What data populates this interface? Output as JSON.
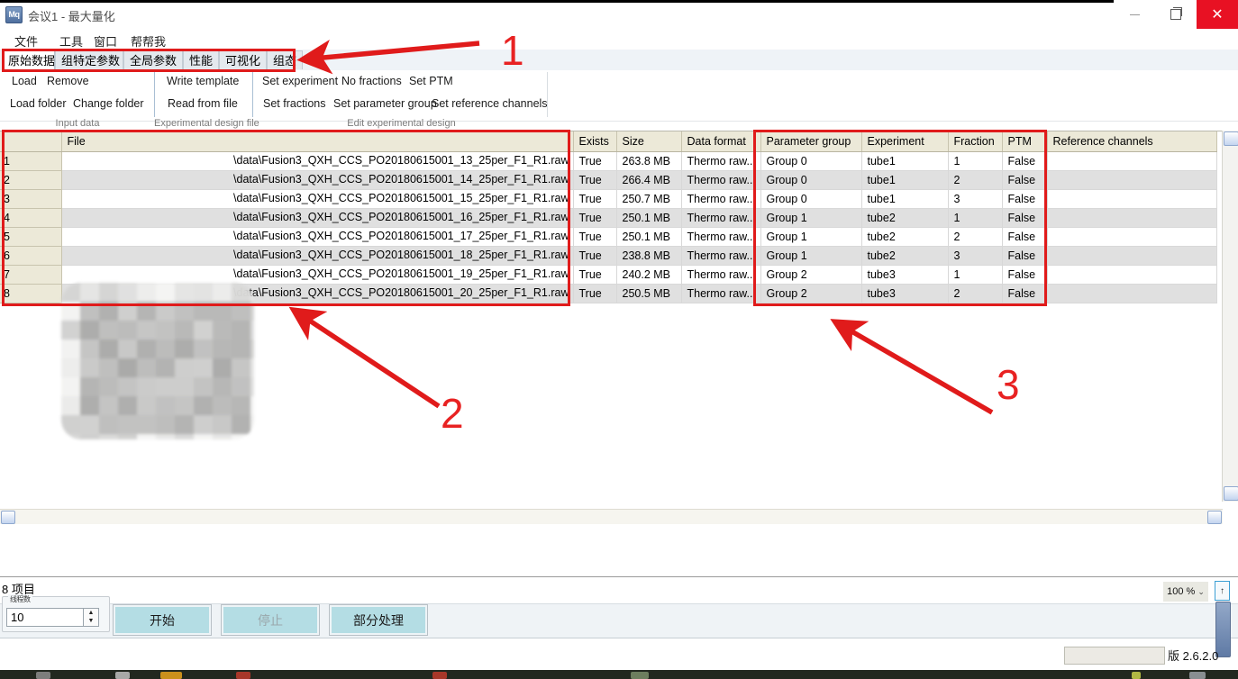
{
  "window": {
    "icon": "maxquant-logo",
    "title": "会议1 - 最大量化",
    "minimize": "–",
    "maximize": "❐",
    "close": "✕"
  },
  "menu": {
    "items": [
      {
        "label": "文件"
      },
      {
        "label": "工具"
      },
      {
        "label": "窗口"
      },
      {
        "label": "帮帮我"
      }
    ]
  },
  "tabs": [
    {
      "label": "原始数据",
      "active": true
    },
    {
      "label": "组特定参数",
      "active": false
    },
    {
      "label": "全局参数",
      "active": false
    },
    {
      "label": "性能",
      "active": false
    },
    {
      "label": "可视化",
      "active": false
    },
    {
      "label": "组态",
      "active": false
    }
  ],
  "ribbon": {
    "groups": [
      {
        "caption": "Input data",
        "buttons": [
          "Load",
          "Remove",
          "Load folder",
          "Change folder"
        ]
      },
      {
        "caption": "Experimental design file",
        "buttons": [
          "Write template",
          "Read from file"
        ]
      },
      {
        "caption": "Edit experimental design",
        "buttons": [
          "Set experiment",
          "No fractions",
          "Set PTM",
          "Set fractions",
          "Set parameter group",
          "Set reference channels"
        ]
      }
    ]
  },
  "table": {
    "columns": [
      "",
      "File",
      "Exists",
      "Size",
      "Data format",
      "Parameter group",
      "Experiment",
      "Fraction",
      "PTM",
      "Reference channels"
    ],
    "rows": [
      {
        "num": "1",
        "file": "\\data\\Fusion3_QXH_CCS_PO20180615001_13_25per_F1_R1.raw",
        "exists": "True",
        "size": "263.8 MB",
        "format": "Thermo raw...",
        "group": "Group 0",
        "experiment": "tube1",
        "fraction": "1",
        "ptm": "False",
        "refchannels": ""
      },
      {
        "num": "2",
        "file": "\\data\\Fusion3_QXH_CCS_PO20180615001_14_25per_F1_R1.raw",
        "exists": "True",
        "size": "266.4 MB",
        "format": "Thermo raw...",
        "group": "Group 0",
        "experiment": "tube1",
        "fraction": "2",
        "ptm": "False",
        "refchannels": ""
      },
      {
        "num": "3",
        "file": "\\data\\Fusion3_QXH_CCS_PO20180615001_15_25per_F1_R1.raw",
        "exists": "True",
        "size": "250.7 MB",
        "format": "Thermo raw...",
        "group": "Group 0",
        "experiment": "tube1",
        "fraction": "3",
        "ptm": "False",
        "refchannels": ""
      },
      {
        "num": "4",
        "file": "\\data\\Fusion3_QXH_CCS_PO20180615001_16_25per_F1_R1.raw",
        "exists": "True",
        "size": "250.1 MB",
        "format": "Thermo raw...",
        "group": "Group 1",
        "experiment": "tube2",
        "fraction": "1",
        "ptm": "False",
        "refchannels": ""
      },
      {
        "num": "5",
        "file": "\\data\\Fusion3_QXH_CCS_PO20180615001_17_25per_F1_R1.raw",
        "exists": "True",
        "size": "250.1 MB",
        "format": "Thermo raw...",
        "group": "Group 1",
        "experiment": "tube2",
        "fraction": "2",
        "ptm": "False",
        "refchannels": ""
      },
      {
        "num": "6",
        "file": "\\data\\Fusion3_QXH_CCS_PO20180615001_18_25per_F1_R1.raw",
        "exists": "True",
        "size": "238.8 MB",
        "format": "Thermo raw...",
        "group": "Group 1",
        "experiment": "tube2",
        "fraction": "3",
        "ptm": "False",
        "refchannels": ""
      },
      {
        "num": "7",
        "file": "\\data\\Fusion3_QXH_CCS_PO20180615001_19_25per_F1_R1.raw",
        "exists": "True",
        "size": "240.2 MB",
        "format": "Thermo raw...",
        "group": "Group 2",
        "experiment": "tube3",
        "fraction": "1",
        "ptm": "False",
        "refchannels": ""
      },
      {
        "num": "8",
        "file": "\\data\\Fusion3_QXH_CCS_PO20180615001_20_25per_F1_R1.raw",
        "exists": "True",
        "size": "250.5 MB",
        "format": "Thermo raw...",
        "group": "Group 2",
        "experiment": "tube3",
        "fraction": "2",
        "ptm": "False",
        "refchannels": ""
      }
    ]
  },
  "status": {
    "item_count": "8 项目"
  },
  "controls": {
    "threads_label": "线程数",
    "threads_value": "10",
    "start": "开始",
    "stop": "停止",
    "partial": "部分处理"
  },
  "footer": {
    "zoom": "100 %",
    "zoom_chevron": "⌄",
    "scroll_up": "↑",
    "version": "版 2.6.2.0"
  },
  "annotations": [
    {
      "id": "1",
      "label": "1"
    },
    {
      "id": "2",
      "label": "2"
    },
    {
      "id": "3",
      "label": "3"
    }
  ],
  "colors": {
    "annotation_red": "#e01b1b",
    "close_red": "#e81123",
    "button_cyan": "#b4dde4",
    "header_beige": "#ece9d8"
  }
}
